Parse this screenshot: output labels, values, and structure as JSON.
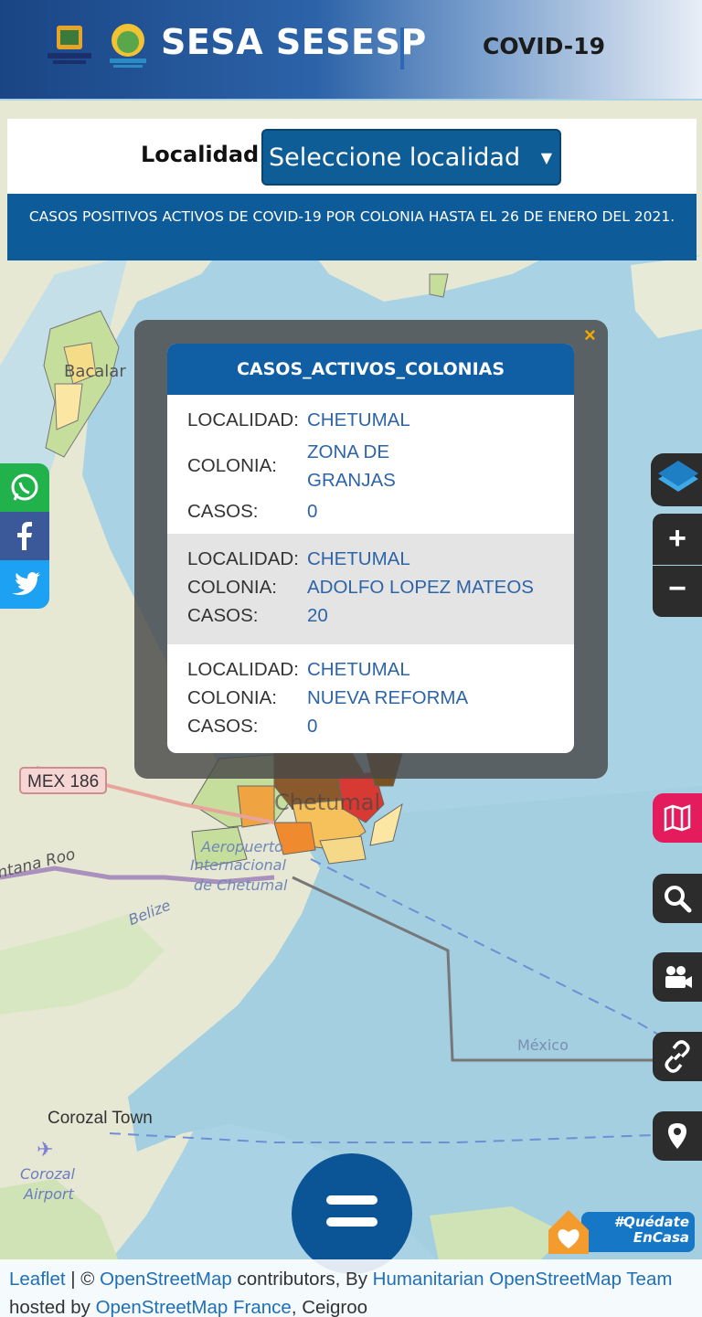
{
  "header": {
    "brand": "SESA SESESP",
    "section": "COVID-19"
  },
  "filter": {
    "label": "Localidad",
    "selected": "Seleccione localidad",
    "caret": "▼"
  },
  "notice": "CASOS POSITIVOS ACTIVOS DE COVID-19 POR COLONIA HASTA EL 26 DE ENERO DEL 2021.",
  "popup": {
    "close": "×",
    "title": "CASOS_ACTIVOS_COLONIAS",
    "keys": {
      "localidad": "LOCALIDAD:",
      "colonia": "COLONIA:",
      "casos": "CASOS:"
    },
    "records": [
      {
        "localidad": "CHETUMAL",
        "colonia": "ZONA DE GRANJAS",
        "casos": "0"
      },
      {
        "localidad": "CHETUMAL",
        "colonia": "ADOLFO LOPEZ MATEOS",
        "casos": "20"
      },
      {
        "localidad": "CHETUMAL",
        "colonia": "NUEVA REFORMA",
        "casos": "0"
      }
    ]
  },
  "map_labels": {
    "bacalar": "Bacalar",
    "road": "MEX 186",
    "chetumal": "Chetumal",
    "quintana_roo": "ntana Roo",
    "airport": "Aeropuerto Internacional de Chetumal",
    "belize": "Belize",
    "mexico": "México",
    "corozal_town": "Corozal Town",
    "corozal_airport": "Corozal Airport"
  },
  "controls": {
    "zoom_in": "+",
    "zoom_out": "−"
  },
  "badge": "#Quédate EnCasa",
  "attribution": {
    "leaflet": "Leaflet",
    "sep1": " | © ",
    "osm": "OpenStreetMap",
    "contrib": " contributors, By ",
    "hot": "Humanitarian OpenStreetMap Team",
    "hosted": " hosted by ",
    "osmfr": "OpenStreetMap France",
    "tail": ", Ceigroo"
  },
  "colors": {
    "header_blue": "#1a4585",
    "notice_blue": "#0d5b99",
    "popup_head": "#105ea3",
    "value_text": "#2d64a8",
    "whatsapp": "#22b24c",
    "facebook": "#3b5998",
    "twitter": "#1da1f2",
    "map_btn": "#e41c5e",
    "water": "#a9d3e4",
    "land": "#e8ead8"
  }
}
